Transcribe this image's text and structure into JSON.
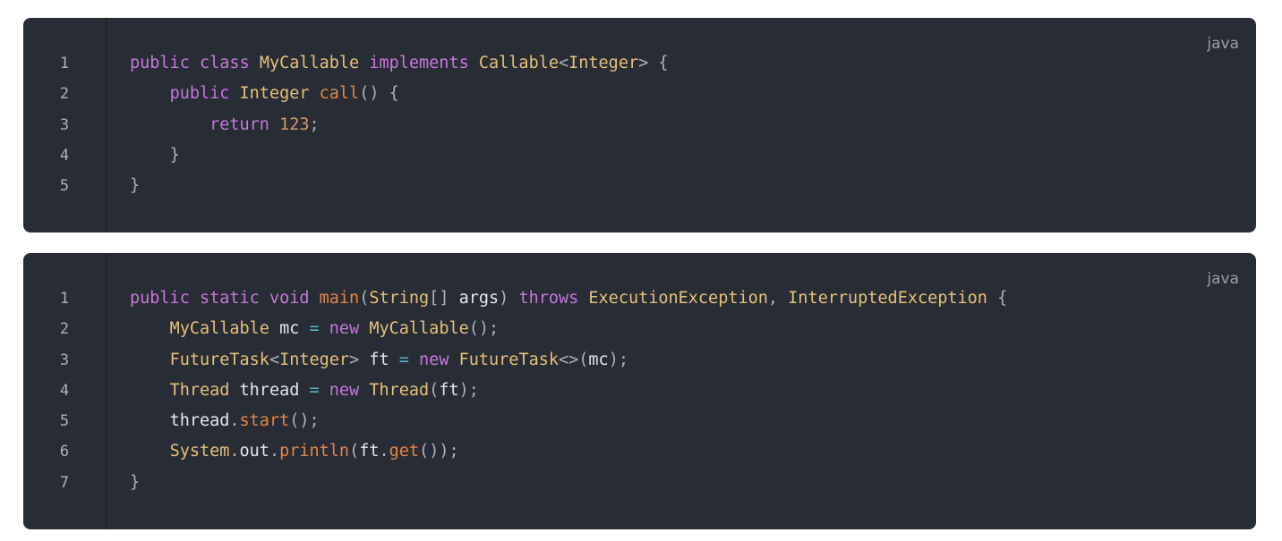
{
  "blocks": [
    {
      "language": "java",
      "line_numbers": [
        "1",
        "2",
        "3",
        "4",
        "5"
      ],
      "lines": [
        "public class MyCallable implements Callable<Integer> {",
        "    public Integer call() {",
        "        return 123;",
        "    }",
        "}"
      ]
    },
    {
      "language": "java",
      "line_numbers": [
        "1",
        "2",
        "3",
        "4",
        "5",
        "6",
        "7"
      ],
      "lines": [
        "public static void main(String[] args) throws ExecutionException, InterruptedException {",
        "    MyCallable mc = new MyCallable();",
        "    FutureTask<Integer> ft = new FutureTask<>(mc);",
        "    Thread thread = new Thread(ft);",
        "    thread.start();",
        "    System.out.println(ft.get());",
        "}"
      ]
    }
  ],
  "colors": {
    "background": "#282c34",
    "keyword": "#c678dd",
    "type": "#e5c07b",
    "function": "#e48547",
    "number": "#d19a66",
    "operator": "#56b6c2",
    "variable": "#e6e6e6",
    "punctuation": "#abb2bf"
  }
}
